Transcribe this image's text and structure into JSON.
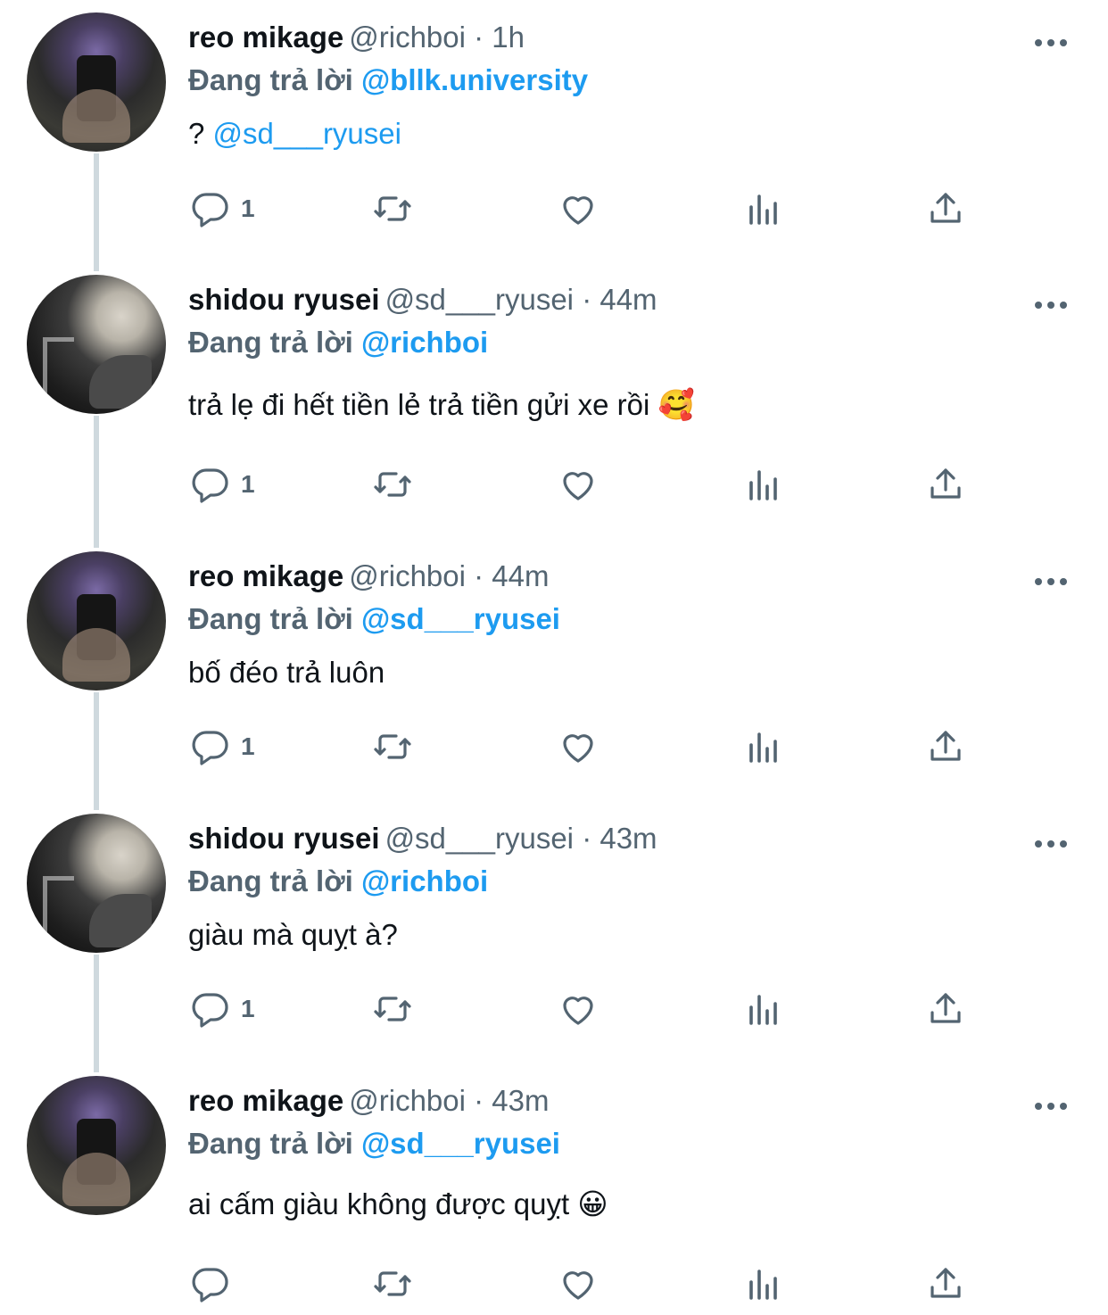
{
  "reply_prefix": "Đang trả lời",
  "tweets": [
    {
      "name": "reo mikage",
      "handle": "@richboi",
      "time": "· 1h",
      "reply_to": "@bllk.university",
      "text_prefix": "?",
      "text_mention": "@sd___ryusei",
      "text": "",
      "reply_count": "1"
    },
    {
      "name": "shidou ryusei",
      "handle": "@sd___ryusei",
      "time": "· 44m",
      "reply_to": "@richboi",
      "text": "trả lẹ đi hết tiền lẻ trả tiền gửi xe rồi 🥰",
      "reply_count": "1"
    },
    {
      "name": "reo mikage",
      "handle": "@richboi",
      "time": "· 44m",
      "reply_to": "@sd___ryusei",
      "text": "bố đéo trả luôn",
      "reply_count": "1"
    },
    {
      "name": "shidou ryusei",
      "handle": "@sd___ryusei",
      "time": "· 43m",
      "reply_to": "@richboi",
      "text": "giàu mà quỵt à?",
      "reply_count": "1"
    },
    {
      "name": "reo mikage",
      "handle": "@richboi",
      "time": "· 43m",
      "reply_to": "@sd___ryusei",
      "text": "ai cấm giàu không được quỵt 😀",
      "reply_count": ""
    }
  ],
  "icons": {
    "reply": "reply-icon",
    "retweet": "retweet-icon",
    "like": "heart-icon",
    "views": "views-icon",
    "share": "share-icon",
    "more": "more-icon"
  },
  "colors": {
    "mention": "#1d9bf0",
    "secondary_text": "#536471",
    "thread_line": "#cfd9de"
  }
}
